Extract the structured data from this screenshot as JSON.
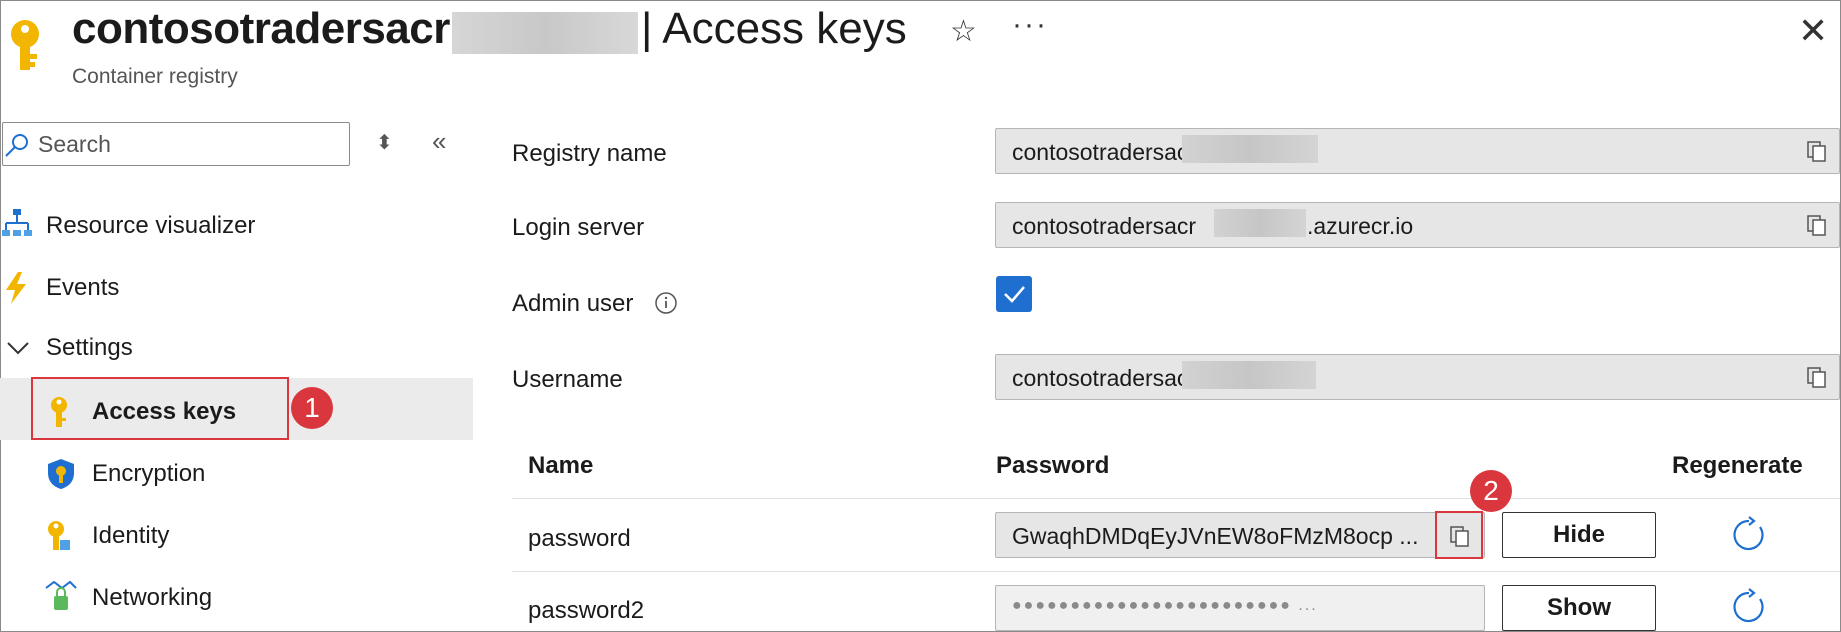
{
  "header": {
    "title_prefix": "contosotradersacr",
    "title_suffix": "| Access keys",
    "subtitle": "Container registry",
    "star_icon": "star-icon",
    "more_icon": "more-icon",
    "close_icon": "close-icon"
  },
  "sidebar": {
    "search_placeholder": "Search",
    "items": [
      {
        "label": "Resource visualizer",
        "icon": "resource-visualizer-icon"
      },
      {
        "label": "Events",
        "icon": "lightning-icon"
      },
      {
        "label": "Settings",
        "icon": "chevron-down-icon"
      },
      {
        "label": "Access keys",
        "icon": "key-icon",
        "selected": true
      },
      {
        "label": "Encryption",
        "icon": "shield-key-icon"
      },
      {
        "label": "Identity",
        "icon": "identity-key-icon"
      },
      {
        "label": "Networking",
        "icon": "network-lock-icon"
      }
    ]
  },
  "form": {
    "registry_name_label": "Registry name",
    "registry_name_value": "contosotradersacr",
    "login_server_label": "Login server",
    "login_server_prefix": "contosotradersacr",
    "login_server_suffix": ".azurecr.io",
    "admin_user_label": "Admin user",
    "admin_user_checked": true,
    "username_label": "Username",
    "username_value": "contosotradersacr"
  },
  "passwords": {
    "headers": {
      "name": "Name",
      "password": "Password",
      "regenerate": "Regenerate"
    },
    "rows": [
      {
        "name": "password",
        "value": "GwaqhDMDqEyJVnEW8oFMzM8ocp ...",
        "button": "Hide"
      },
      {
        "name": "password2",
        "value": "●●●●●●●●●●●●●●●●●●●●●●●● ...",
        "button": "Show"
      }
    ]
  },
  "annotations": {
    "step1": "1",
    "step2": "2"
  },
  "colors": {
    "accent": "#1f6fd1",
    "highlight": "#d9363e",
    "key": "#f2b600"
  }
}
